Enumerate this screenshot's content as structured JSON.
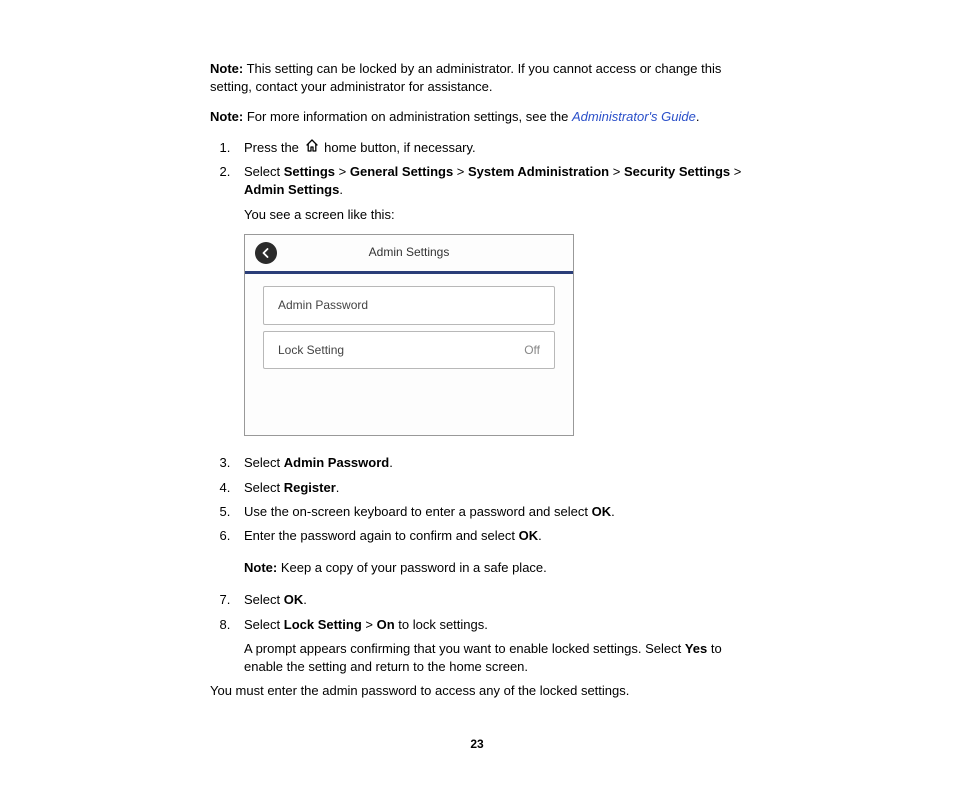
{
  "note1": {
    "label": "Note:",
    "text": " This setting can be locked by an administrator. If you cannot access or change this setting, contact your administrator for assistance."
  },
  "note2": {
    "label": "Note:",
    "text": " For more information on administration settings, see the ",
    "link": "Administrator's Guide",
    "after": "."
  },
  "steps": {
    "s1_pre": "Press the ",
    "s1_post": " home button, if necessary.",
    "s2_select": "Select ",
    "s2_a": "Settings",
    "s2_b": "General Settings",
    "s2_c": "System Administration",
    "s2_d": "Security Settings",
    "s2_e": "Admin Settings",
    "s2_followup": "You see a screen like this:",
    "s3_pre": "Select ",
    "s3_bold": "Admin Password",
    "s4_pre": "Select ",
    "s4_bold": "Register",
    "s5_pre": "Use the on-screen keyboard to enter a password and select ",
    "s5_bold": "OK",
    "s6_pre": "Enter the password again to confirm and select ",
    "s6_bold": "OK",
    "s6_note_label": "Note:",
    "s6_note_text": " Keep a copy of your password in a safe place.",
    "s7_pre": "Select ",
    "s7_bold": "OK",
    "s8_pre": "Select ",
    "s8_bold_a": "Lock Setting",
    "s8_bold_b": "On",
    "s8_post": " to lock settings.",
    "s8_follow_a": "A prompt appears confirming that you want to enable locked settings. Select ",
    "s8_follow_bold": "Yes",
    "s8_follow_b": " to enable the setting and return to the home screen."
  },
  "gt": " > ",
  "period": ".",
  "device": {
    "title": "Admin Settings",
    "item1": "Admin Password",
    "item2": "Lock Setting",
    "item2_value": "Off"
  },
  "closing": "You must enter the admin password to access any of the locked settings.",
  "page_number": "23"
}
